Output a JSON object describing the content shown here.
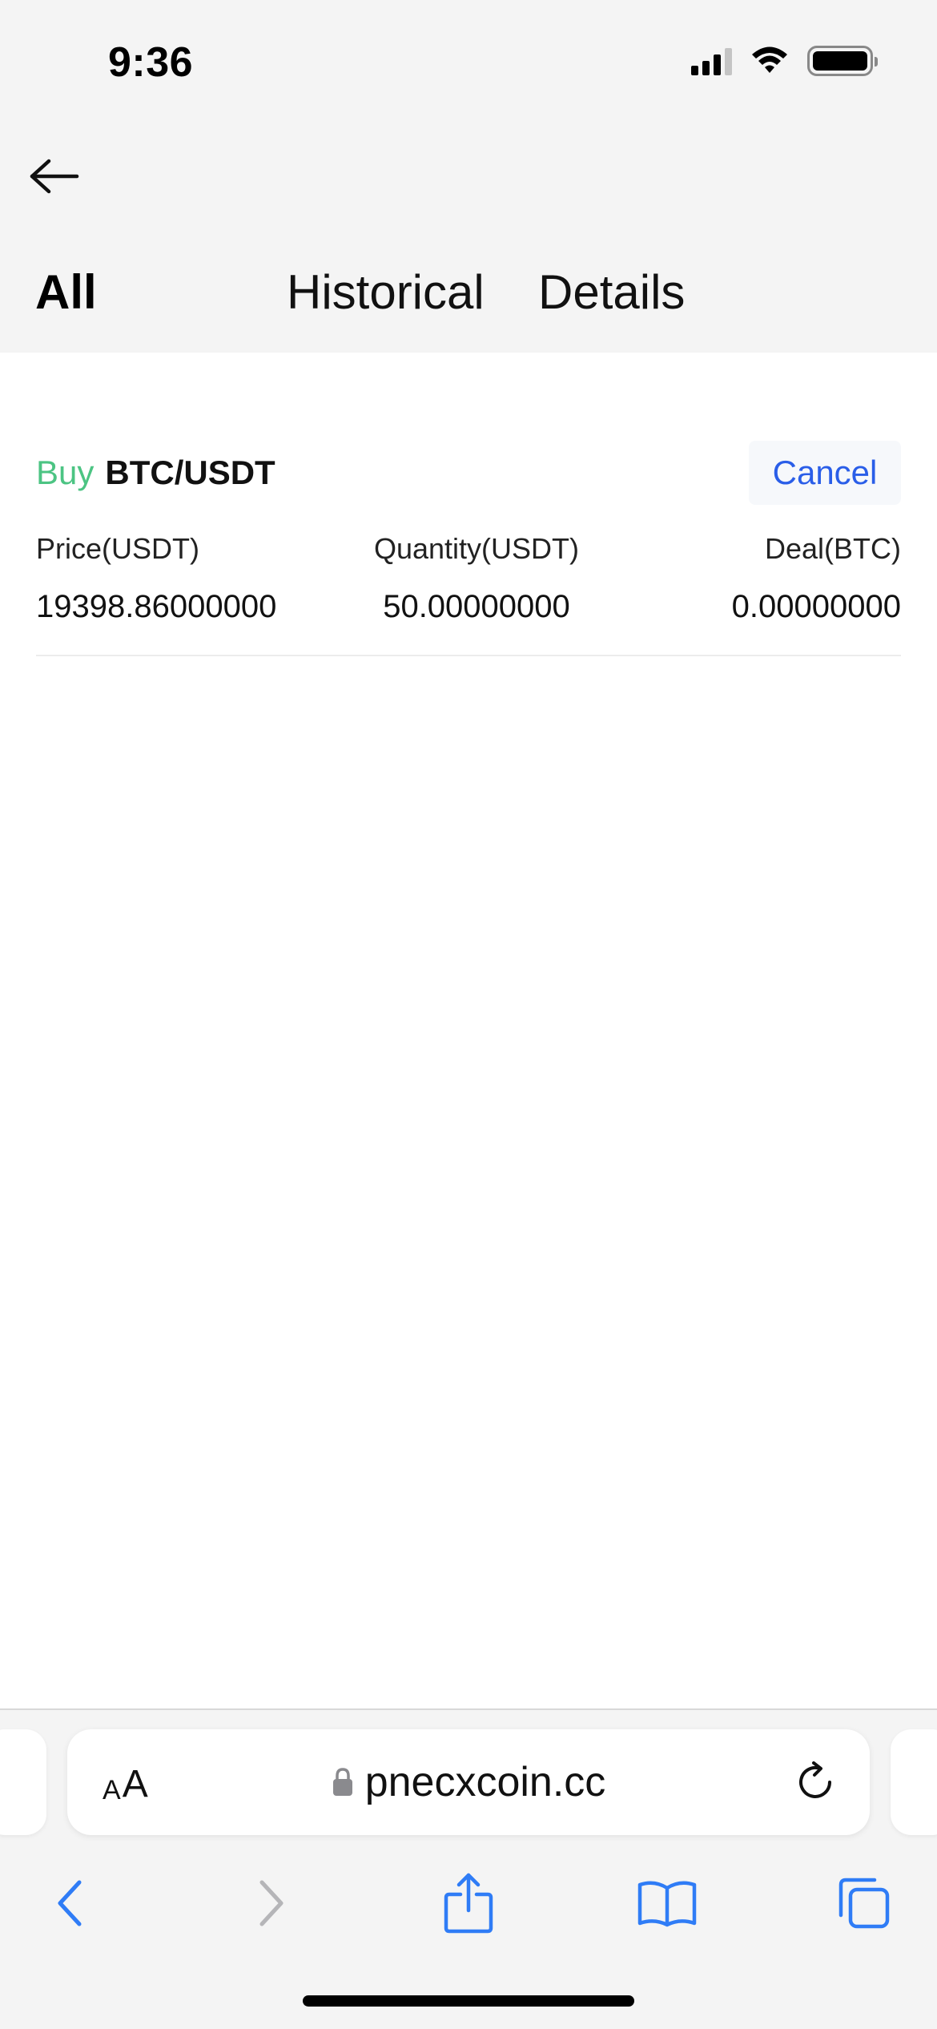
{
  "status_bar": {
    "time": "9:36"
  },
  "header": {
    "back_icon": "arrow-left-icon"
  },
  "tabs": [
    {
      "label": "All",
      "active": true
    },
    {
      "label": "Historical",
      "active": false
    },
    {
      "label": "Details",
      "active": false
    }
  ],
  "order": {
    "side": "Buy",
    "pair": "BTC/USDT",
    "cancel_label": "Cancel",
    "columns": [
      "Price(USDT)",
      "Quantity(USDT)",
      "Deal(BTC)"
    ],
    "values": [
      "19398.86000000",
      "50.00000000",
      "0.00000000"
    ]
  },
  "browser": {
    "text_size_label_small": "A",
    "text_size_label_large": "A",
    "url": "pnecxcoin.cc",
    "icons": [
      "lock-icon",
      "reload-icon",
      "back-chevron-icon",
      "forward-chevron-icon",
      "share-icon",
      "bookmarks-icon",
      "tabs-icon"
    ]
  },
  "colors": {
    "buy": "#4cc483",
    "cancel": "#2a5ee8",
    "safari_blue": "#2f7cf6",
    "header_bg": "#f4f4f4"
  }
}
